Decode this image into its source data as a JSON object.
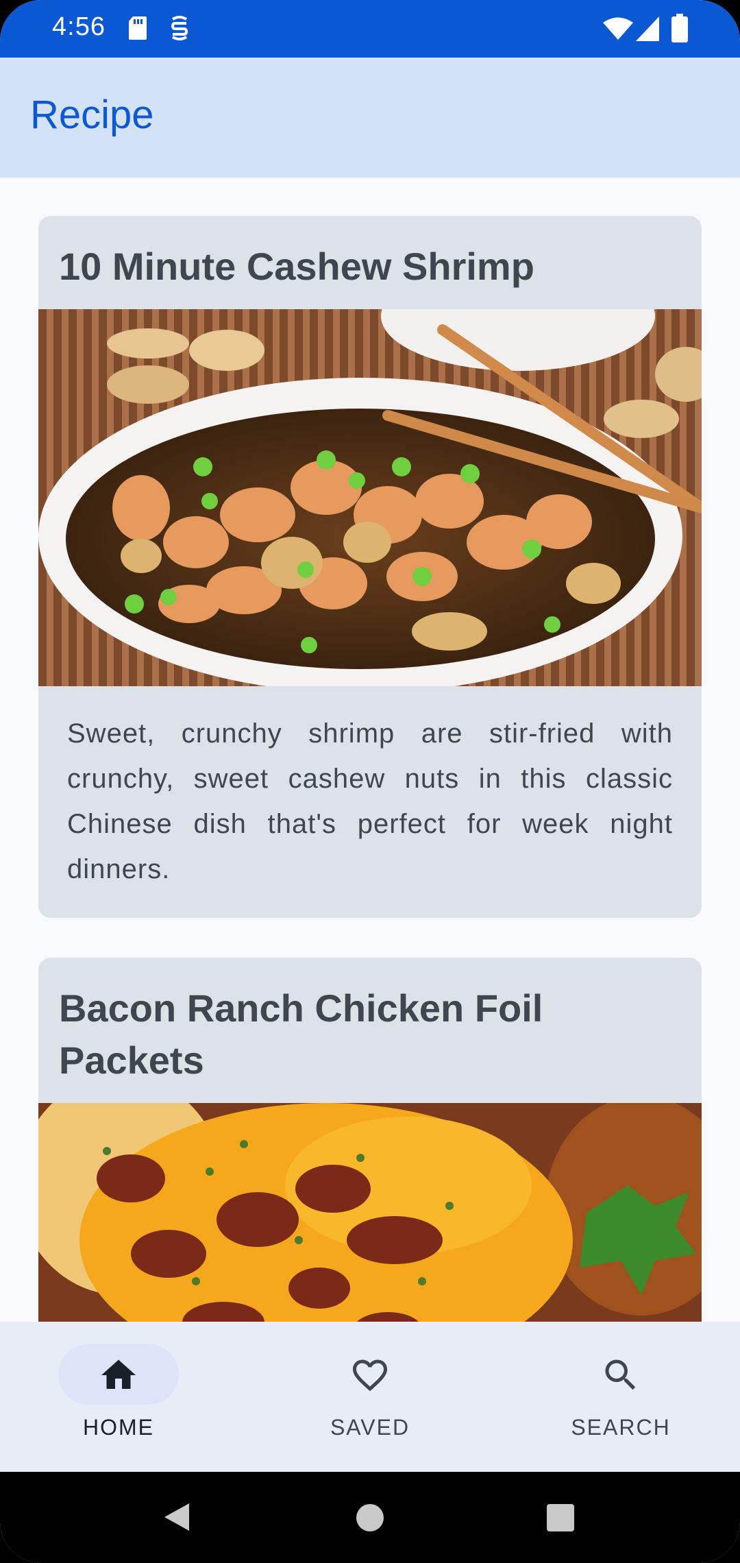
{
  "status_bar": {
    "time": "4:56",
    "left_icons": [
      "sd-card-icon",
      "sync-status-icon"
    ],
    "right_icons": [
      "wifi-icon",
      "cell-signal-icon",
      "battery-icon"
    ],
    "color": "#0b58d4"
  },
  "app_bar": {
    "title": "Recipe",
    "background": "#d4e2f8",
    "title_color": "#0b58d4"
  },
  "recipes": [
    {
      "title": "10 Minute Cashew Shrimp",
      "image": "cashew-shrimp-dish-photo",
      "description": "Sweet, crunchy shrimp are stir-fried with crunchy, sweet cashew nuts in this classic Chinese dish that's perfect for week night dinners."
    },
    {
      "title": "Bacon Ranch Chicken Foil Packets",
      "image": "bacon-ranch-chicken-photo",
      "description": ""
    }
  ],
  "bottom_nav": {
    "items": [
      {
        "label": "HOME",
        "icon": "home-icon",
        "selected": true
      },
      {
        "label": "SAVED",
        "icon": "heart-icon",
        "selected": false
      },
      {
        "label": "SEARCH",
        "icon": "search-icon",
        "selected": false
      }
    ]
  },
  "system_nav": {
    "buttons": [
      "back-icon",
      "home-circle-icon",
      "recents-icon"
    ]
  }
}
